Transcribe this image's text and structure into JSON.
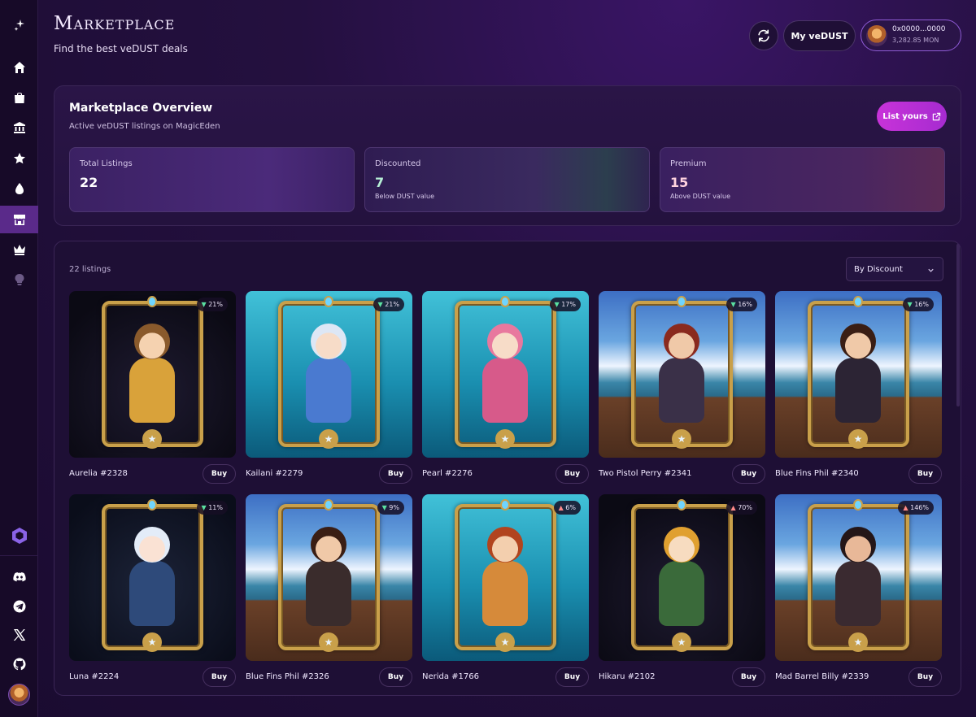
{
  "sidebar": {
    "items": [
      {
        "icon": "sparkle-icon"
      },
      {
        "icon": "home-icon"
      },
      {
        "icon": "shopping-bag-icon"
      },
      {
        "icon": "bank-icon"
      },
      {
        "icon": "star-icon"
      },
      {
        "icon": "drop-icon"
      },
      {
        "icon": "storefront-icon",
        "active": true
      },
      {
        "icon": "crown-icon"
      },
      {
        "icon": "lightbulb-icon",
        "dim": true
      }
    ],
    "bottom": [
      "hexagon-logo-icon",
      "discord-icon",
      "telegram-icon",
      "x-icon",
      "github-icon",
      "avatar"
    ]
  },
  "header": {
    "title": "Marketplace",
    "subtitle": "Find the best veDUST deals",
    "vedust_label": "My veDUST",
    "wallet_address": "0x0000...0000",
    "wallet_balance": "3,282.85 MON"
  },
  "overview": {
    "title": "Marketplace Overview",
    "subtitle": "Active veDUST listings on MagicEden",
    "list_button": "List yours",
    "stats": [
      {
        "label": "Total Listings",
        "value": "22",
        "note": ""
      },
      {
        "label": "Discounted",
        "value": "7",
        "note": "Below DUST value"
      },
      {
        "label": "Premium",
        "value": "15",
        "note": "Above DUST value"
      }
    ]
  },
  "listings": {
    "count": "22 listings",
    "sort": "By Discount",
    "buy_label": "Buy",
    "cards": [
      {
        "name": "Aurelia #2328",
        "badge": "21%",
        "dir": "down",
        "bg": "dark",
        "hair": "#8a5a2c",
        "skin": "#f5d2b0",
        "outfit": "#d9a23a"
      },
      {
        "name": "Kailani #2279",
        "badge": "21%",
        "dir": "down",
        "bg": "sea",
        "hair": "#dde7f5",
        "skin": "#f7dcc8",
        "outfit": "#4a7ad0"
      },
      {
        "name": "Pearl #2276",
        "badge": "17%",
        "dir": "down",
        "bg": "sea",
        "hair": "#e8789e",
        "skin": "#f7dcc8",
        "outfit": "#d75a8a"
      },
      {
        "name": "Two Pistol Perry #2341",
        "badge": "16%",
        "dir": "down",
        "bg": "ship",
        "hair": "#8a2a1e",
        "skin": "#f0c9a8",
        "outfit": "#3a3048"
      },
      {
        "name": "Blue Fins Phil #2340",
        "badge": "16%",
        "dir": "down",
        "bg": "ship",
        "hair": "#3a1e14",
        "skin": "#f0c9a8",
        "outfit": "#2c2434"
      },
      {
        "name": "Luna #2224",
        "badge": "11%",
        "dir": "down",
        "bg": "night",
        "hair": "#e3ecf8",
        "skin": "#fae2d4",
        "outfit": "#2e4a7a"
      },
      {
        "name": "Blue Fins Phil #2326",
        "badge": "9%",
        "dir": "down",
        "bg": "ship",
        "hair": "#3a1e14",
        "skin": "#f0c9a8",
        "outfit": "#3a2c2c"
      },
      {
        "name": "Nerida #1766",
        "badge": "6%",
        "dir": "up",
        "bg": "sea",
        "hair": "#b1441e",
        "skin": "#f3cfae",
        "outfit": "#d68a3a"
      },
      {
        "name": "Hikaru #2102",
        "badge": "70%",
        "dir": "up",
        "bg": "dark",
        "hair": "#e0a030",
        "skin": "#f7dcc0",
        "outfit": "#3a6a3a"
      },
      {
        "name": "Mad Barrel Billy #2339",
        "badge": "146%",
        "dir": "up",
        "bg": "ship",
        "hair": "#241618",
        "skin": "#e8b898",
        "outfit": "#3a2a30"
      }
    ]
  }
}
